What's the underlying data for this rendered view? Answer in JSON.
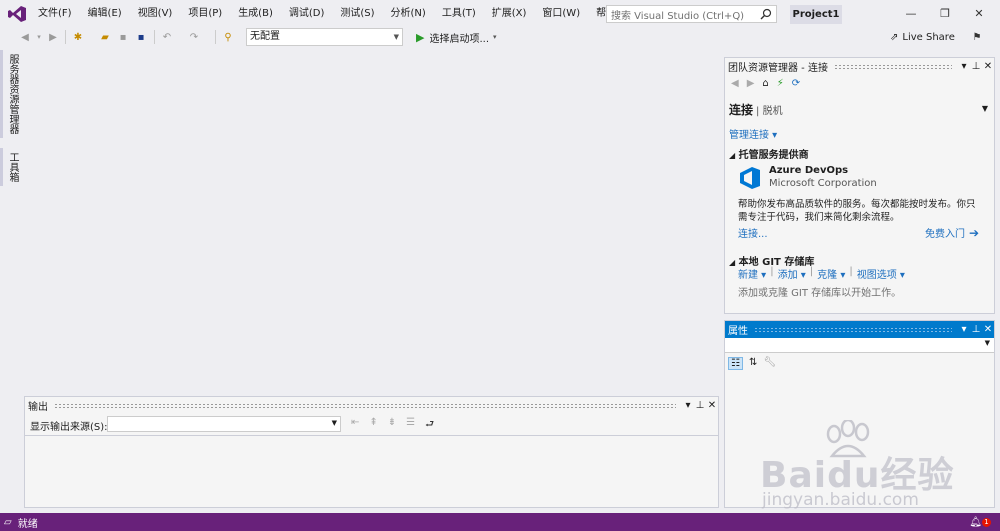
{
  "menu": [
    "文件(F)",
    "编辑(E)",
    "视图(V)",
    "项目(P)",
    "生成(B)",
    "调试(D)",
    "测试(S)",
    "分析(N)",
    "工具(T)",
    "扩展(X)",
    "窗口(W)",
    "帮助(H)"
  ],
  "search": {
    "placeholder": "搜索 Visual Studio (Ctrl+Q)"
  },
  "project": "Project1",
  "toolbar": {
    "config": "无配置",
    "start": "选择启动项...",
    "live_share": "Live Share"
  },
  "left_tabs": [
    "服务器资源管理器",
    "工具箱"
  ],
  "team": {
    "title": "团队资源管理器 - 连接",
    "heading": "连接",
    "heading_sub": "| 脱机",
    "manage": "管理连接",
    "hosted_title": "托管服务提供商",
    "azure_name": "Azure DevOps",
    "azure_corp": "Microsoft Corporation",
    "azure_desc1": "帮助你发布高品质软件的服务。每次都能按时发布。你只",
    "azure_desc2": "需专注于代码，我们来简化剩余流程。",
    "connect": "连接...",
    "free_start": "免费入门",
    "git_title": "本地 GIT 存储库",
    "git_new": "新建",
    "git_add": "添加",
    "git_clone": "克隆",
    "git_view": "视图选项",
    "git_hint": "添加或克隆 GIT 存储库以开始工作。"
  },
  "properties": {
    "title": "属性"
  },
  "output": {
    "title": "输出",
    "source_label": "显示输出来源(S):"
  },
  "status": {
    "text": "就绪",
    "badge": "1"
  },
  "watermark": {
    "brand": "Baidu经验",
    "url": "jingyan.baidu.com"
  },
  "colors": {
    "accent": "#007acc",
    "status": "#68217a",
    "vs_purple": "#68217a"
  }
}
